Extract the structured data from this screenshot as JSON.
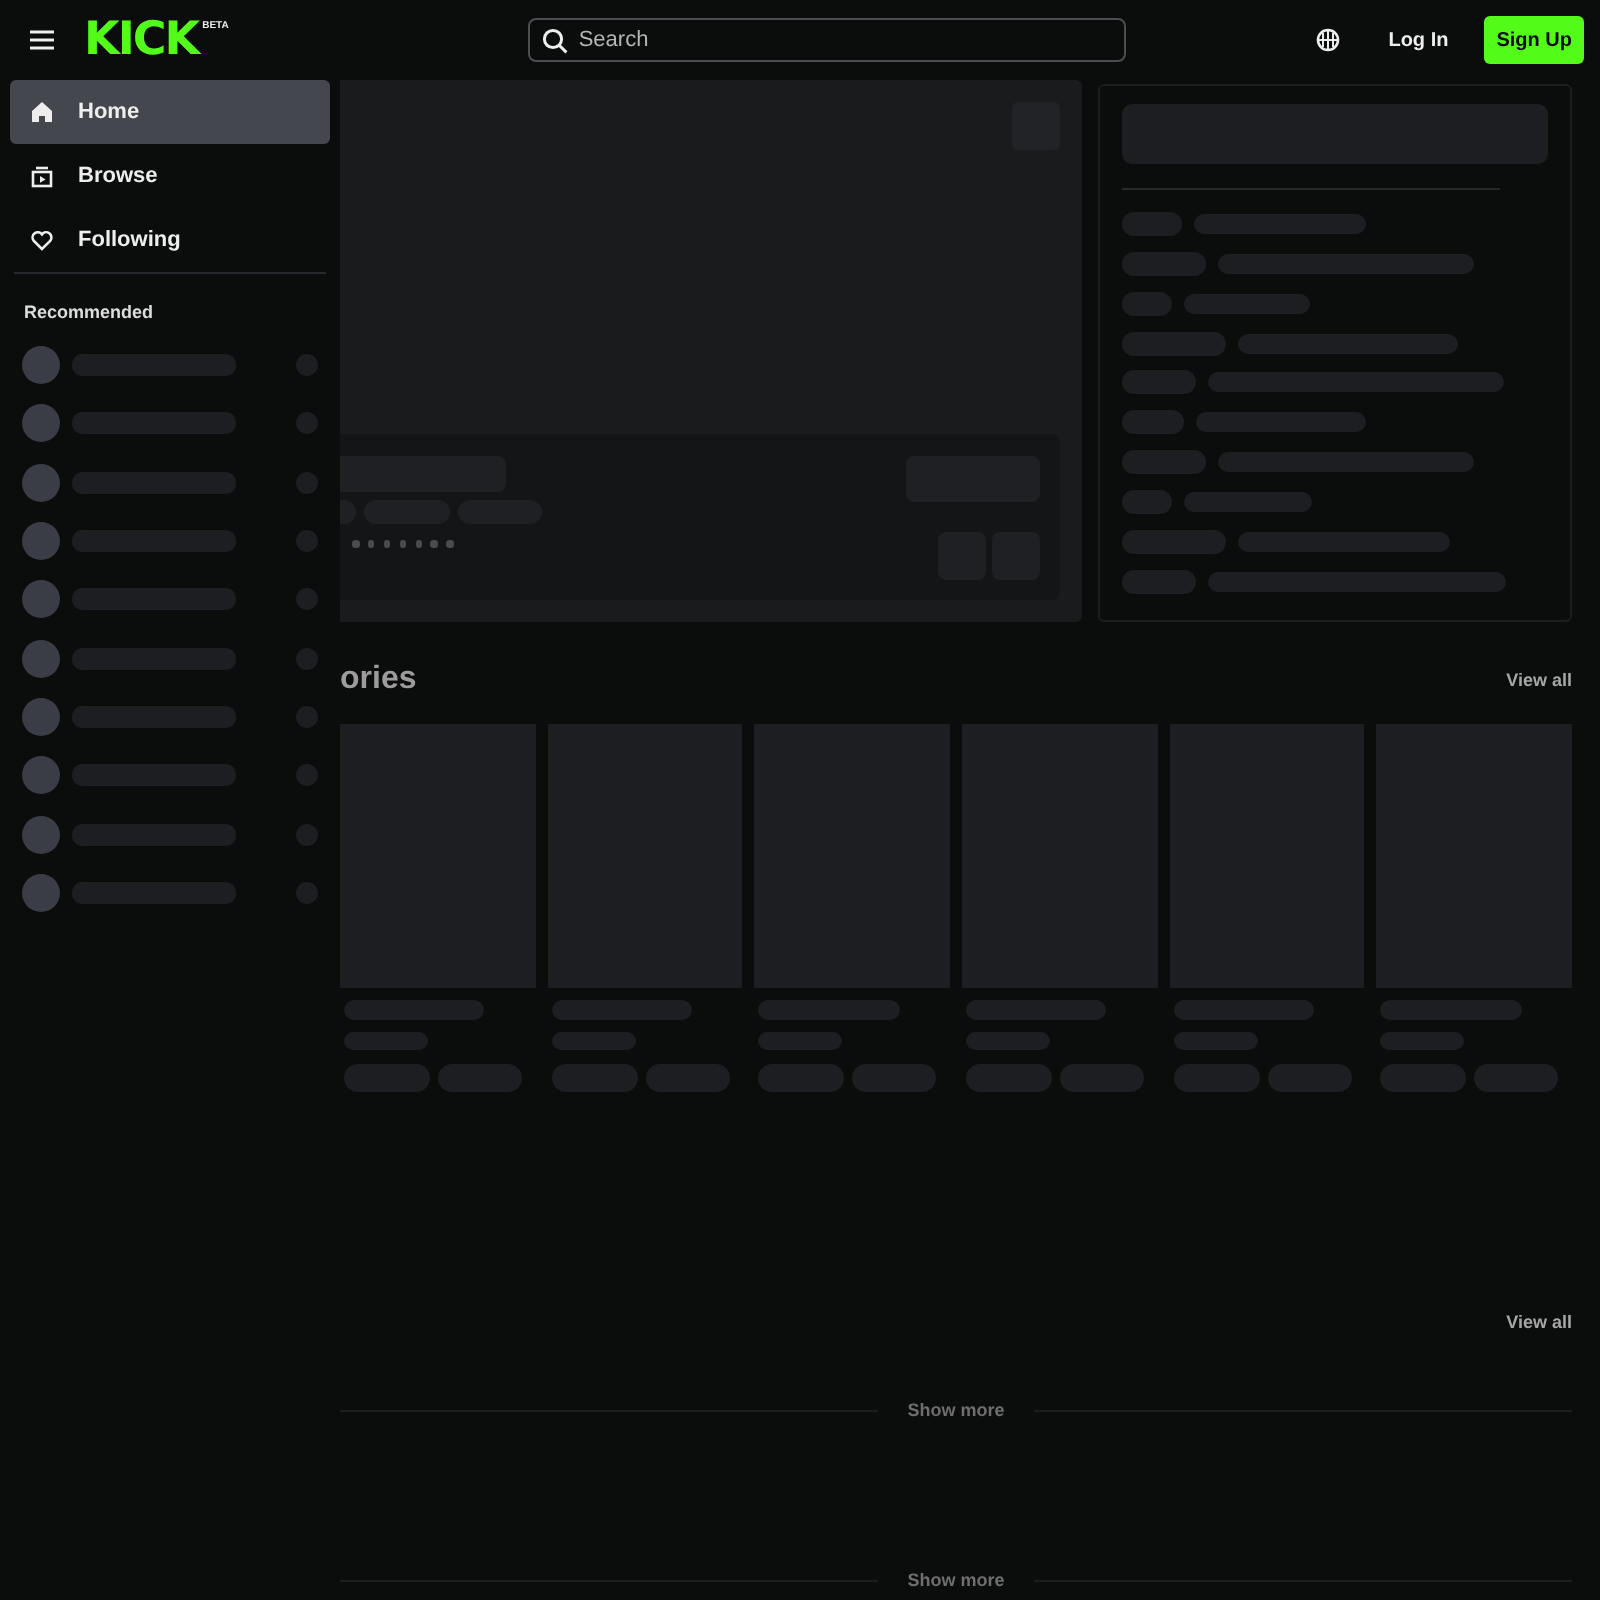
{
  "header": {
    "logo": "KICK",
    "logo_badge": "BETA",
    "search": {
      "placeholder": "Search"
    },
    "buttons": [
      {
        "label": "Log In",
        "kind": "text"
      },
      {
        "label": "Sign Up",
        "kind": "primary"
      }
    ]
  },
  "sidebar": {
    "nav": [
      {
        "label": "Home",
        "selected": true
      },
      {
        "label": "Browse",
        "selected": false
      },
      {
        "label": "Following",
        "selected": false
      }
    ],
    "recommended": {
      "title": "Recommended",
      "channels": [
        {
          "kind": "skeleton"
        },
        {
          "kind": "skeleton"
        },
        {
          "kind": "skeleton"
        },
        {
          "kind": "skeleton"
        },
        {
          "kind": "skeleton"
        },
        {
          "kind": "skeleton"
        },
        {
          "kind": "skeleton"
        },
        {
          "kind": "skeleton"
        },
        {
          "kind": "skeleton"
        },
        {
          "kind": "skeleton"
        }
      ]
    }
  },
  "featured": {
    "loading": true
  },
  "chat": {
    "loading": true
  },
  "sections": [
    {
      "title": "ories",
      "link": "View all",
      "cards": [
        {
          "kind": "skeleton"
        },
        {
          "kind": "skeleton"
        },
        {
          "kind": "skeleton"
        },
        {
          "kind": "skeleton"
        },
        {
          "kind": "skeleton"
        },
        {
          "kind": "skeleton"
        }
      ]
    },
    {
      "link": "View all",
      "show_more": "Show more"
    },
    {
      "show_more": "Show more"
    }
  ]
}
